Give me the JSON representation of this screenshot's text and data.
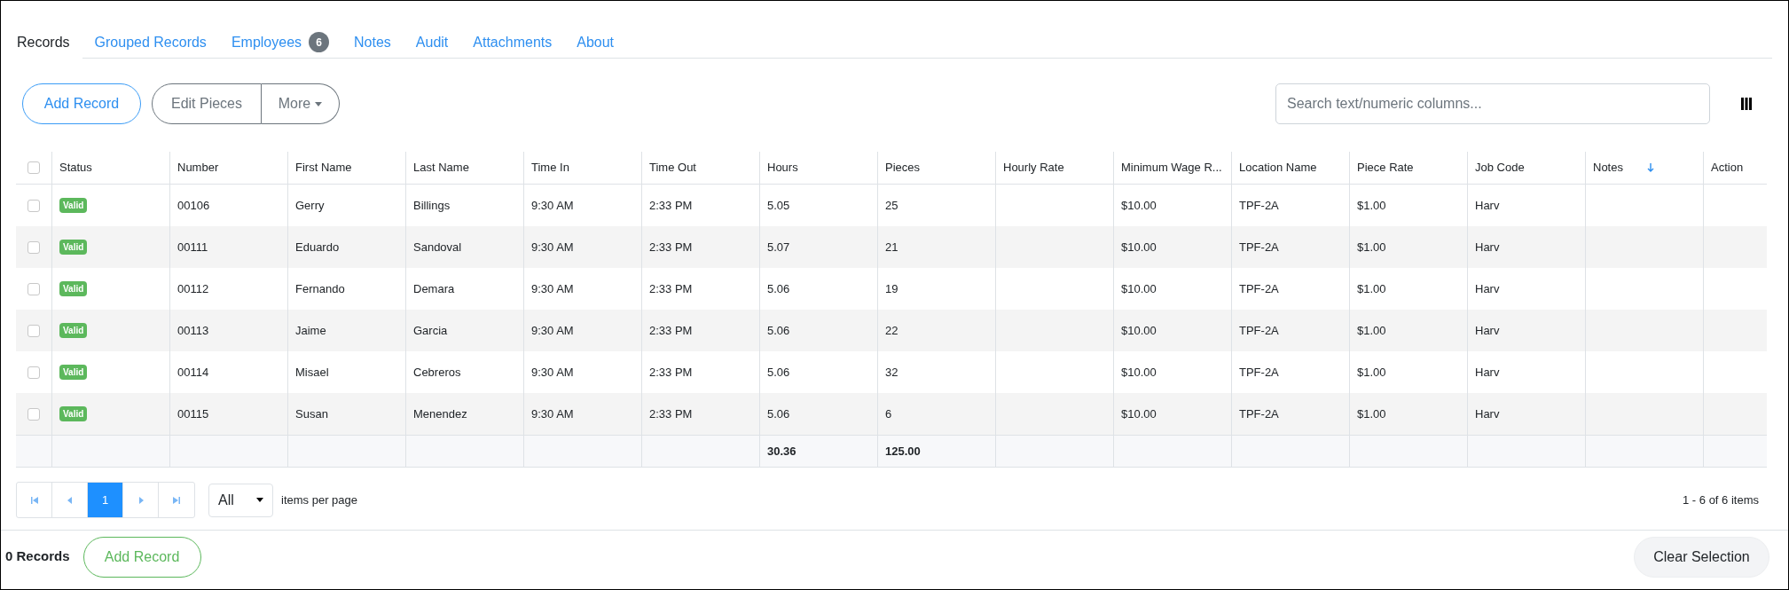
{
  "tabs": [
    {
      "label": "Records",
      "selected": true
    },
    {
      "label": "Grouped Records",
      "selected": false
    },
    {
      "label": "Employees",
      "selected": false,
      "badge": "6"
    },
    {
      "label": "Notes",
      "selected": false
    },
    {
      "label": "Audit",
      "selected": false
    },
    {
      "label": "Attachments",
      "selected": false
    },
    {
      "label": "About",
      "selected": false
    }
  ],
  "toolbar": {
    "add_button": "Add Record",
    "edit_button": "Edit Pieces",
    "more_button": "More",
    "search": {
      "placeholder": "Search text/numeric columns..."
    }
  },
  "table": {
    "select_all_checked": false,
    "columns": [
      {
        "kind": "badge",
        "label": "Status",
        "sorted": false,
        "cells": [
          "Valid",
          "Valid",
          "Valid",
          "Valid",
          "Valid",
          "Valid"
        ]
      },
      {
        "kind": "text",
        "label": "Number",
        "sorted": false,
        "cells": [
          "00106",
          "00111",
          "00112",
          "00113",
          "00114",
          "00115"
        ]
      },
      {
        "kind": "text",
        "label": "First Name",
        "sorted": false,
        "cells": [
          "Gerry",
          "Eduardo",
          "Fernando",
          "Jaime",
          "Misael",
          "Susan"
        ]
      },
      {
        "kind": "text",
        "label": "Last Name",
        "sorted": false,
        "cells": [
          "Billings",
          "Sandoval",
          "Demara",
          "Garcia",
          "Cebreros",
          "Menendez"
        ]
      },
      {
        "kind": "text",
        "label": "Time In",
        "sorted": false,
        "cells": [
          "9:30 AM",
          "9:30 AM",
          "9:30 AM",
          "9:30 AM",
          "9:30 AM",
          "9:30 AM"
        ]
      },
      {
        "kind": "text",
        "label": "Time Out",
        "sorted": false,
        "cells": [
          "2:33 PM",
          "2:33 PM",
          "2:33 PM",
          "2:33 PM",
          "2:33 PM",
          "2:33 PM"
        ]
      },
      {
        "kind": "text",
        "label": "Hours",
        "sorted": false,
        "cells": [
          "5.05",
          "5.07",
          "5.06",
          "5.06",
          "5.06",
          "5.06"
        ],
        "total": "30.36"
      },
      {
        "kind": "text",
        "label": "Pieces",
        "sorted": false,
        "cells": [
          "25",
          "21",
          "19",
          "22",
          "32",
          "6"
        ],
        "total": "125.00"
      },
      {
        "label": "Hourly Rate",
        "sorted": false
      },
      {
        "kind": "text",
        "label": "Minimum Wage R...",
        "sorted": false,
        "cells": [
          "$10.00",
          "$10.00",
          "$10.00",
          "$10.00",
          "$10.00",
          "$10.00"
        ]
      },
      {
        "kind": "text",
        "label": "Location Name",
        "sorted": false,
        "cells": [
          "TPF-2A",
          "TPF-2A",
          "TPF-2A",
          "TPF-2A",
          "TPF-2A",
          "TPF-2A"
        ]
      },
      {
        "kind": "text",
        "label": "Piece Rate",
        "sorted": false,
        "cells": [
          "$1.00",
          "$1.00",
          "$1.00",
          "$1.00",
          "$1.00",
          "$1.00"
        ]
      },
      {
        "kind": "text",
        "label": "Job Code",
        "sorted": false,
        "cells": [
          "Harv",
          "Harv",
          "Harv",
          "Harv",
          "Harv",
          "Harv"
        ]
      },
      {
        "label": "Notes",
        "sorted": true
      },
      {
        "label": "Action",
        "sorted": false
      }
    ],
    "rows": [
      {
        "selected": false
      },
      {
        "selected": false
      },
      {
        "selected": false
      },
      {
        "selected": false
      },
      {
        "selected": false
      },
      {
        "selected": false
      }
    ]
  },
  "pager": {
    "pages": [
      {
        "label": "1",
        "selected": true
      }
    ],
    "page_size": "All",
    "page_size_label": "items per page",
    "summary": "1 - 6 of 6 items"
  },
  "footer": {
    "count": "0 Records",
    "add_button": "Add Record",
    "clear_button": "Clear Selection"
  }
}
